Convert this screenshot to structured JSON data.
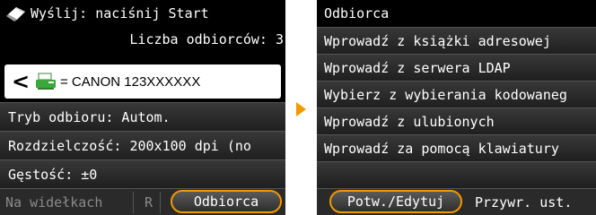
{
  "left_screen": {
    "header": "Wyślij: naciśnij Start",
    "recipient_count": "Liczba odbiorców: 3",
    "destination": {
      "text": "= CANON 123XXXXXX"
    },
    "settings": [
      "Tryb odbioru: Autom.",
      "Rozdzielczość: 200x100 dpi (no",
      "Gęstość: ±0"
    ],
    "bottom_bar": {
      "on_hook": "Na widełkach",
      "r_label": "R",
      "recipient_button": "Odbiorca"
    }
  },
  "right_screen": {
    "title": "Odbiorca",
    "items": [
      "Wprowadź z książki adresowej",
      "Wprowadź z serwera LDAP",
      "Wybierz z wybierania kodowaneg",
      "Wprowadź z ulubionych",
      "Wprowadź za pomocą klawiatury"
    ],
    "bottom_bar": {
      "confirm_edit": "Potw./Edytuj",
      "recall": "Przywr. ust."
    }
  },
  "colors": {
    "accent": "#f39800",
    "screen_bg": "#000000",
    "highlight": "#ffffff"
  },
  "icons": [
    "send-icon",
    "back-icon",
    "fax-icon",
    "next-arrow-icon"
  ]
}
